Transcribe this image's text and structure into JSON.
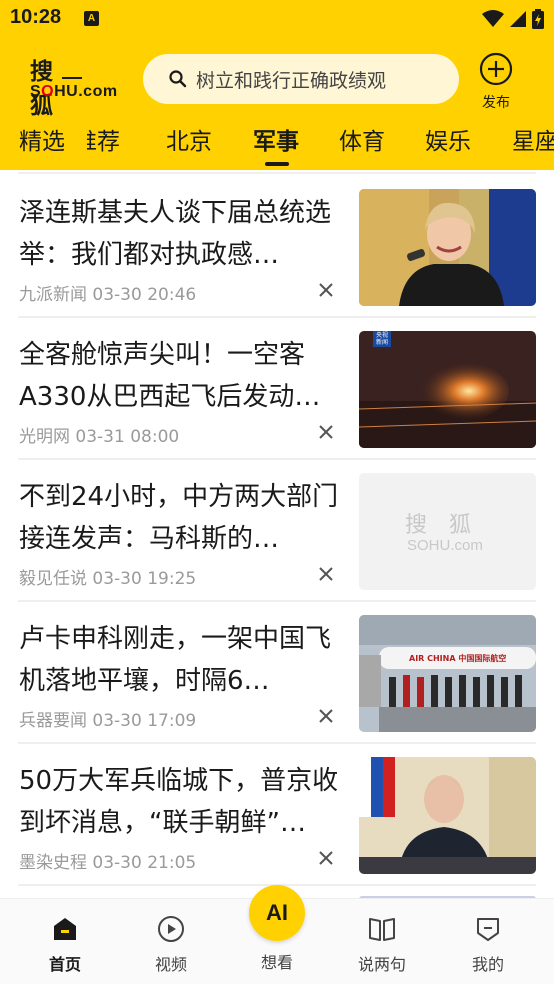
{
  "status_bar": {
    "time": "10:28",
    "notification_badge": "A"
  },
  "header": {
    "logo_cn": "搜狐",
    "logo_en_prefix": "S",
    "logo_en_o": "O",
    "logo_en_suffix": "HU.com",
    "search_placeholder": "树立和践行正确政绩观",
    "publish_label": "发布",
    "accent_color": "#FFD100"
  },
  "tabs": [
    "精选",
    "推荐",
    "北京",
    "军事",
    "体育",
    "娱乐",
    "星座"
  ],
  "active_tab": "军事",
  "feed": [
    {
      "title": "泽连斯基夫人谈下届总统选举：我们都对执政感…",
      "source": "九派新闻",
      "time": "03-30 20:46"
    },
    {
      "title": "全客舱惊声尖叫！一空客A330从巴西起飞后发动…",
      "source": "光明网",
      "time": "03-31 08:00",
      "thumb_badge": "央视\n新闻"
    },
    {
      "title": "不到24小时，中方两大部门接连发声：马科斯的…",
      "source": "毅见任说",
      "time": "03-30 19:25",
      "thumb_logo_cn": "搜狐",
      "thumb_logo_en": "SOHU.com"
    },
    {
      "title": "卢卡申科刚走，一架中国飞机落地平壤，时隔6…",
      "source": "兵器要闻",
      "time": "03-30 17:09",
      "thumb_plane_text": "AIR CHINA 中国国际航空"
    },
    {
      "title": "50万大军兵临城下，普京收到坏消息，“联手朝鲜”…",
      "source": "墨染史程",
      "time": "03-30 21:05"
    }
  ],
  "bottom_nav": [
    {
      "label": "首页",
      "icon": "home-icon"
    },
    {
      "label": "视频",
      "icon": "play-icon"
    },
    {
      "label": "想看",
      "icon": "ai-icon",
      "badge": "AI"
    },
    {
      "label": "说两句",
      "icon": "book-icon"
    },
    {
      "label": "我的",
      "icon": "profile-icon"
    }
  ]
}
